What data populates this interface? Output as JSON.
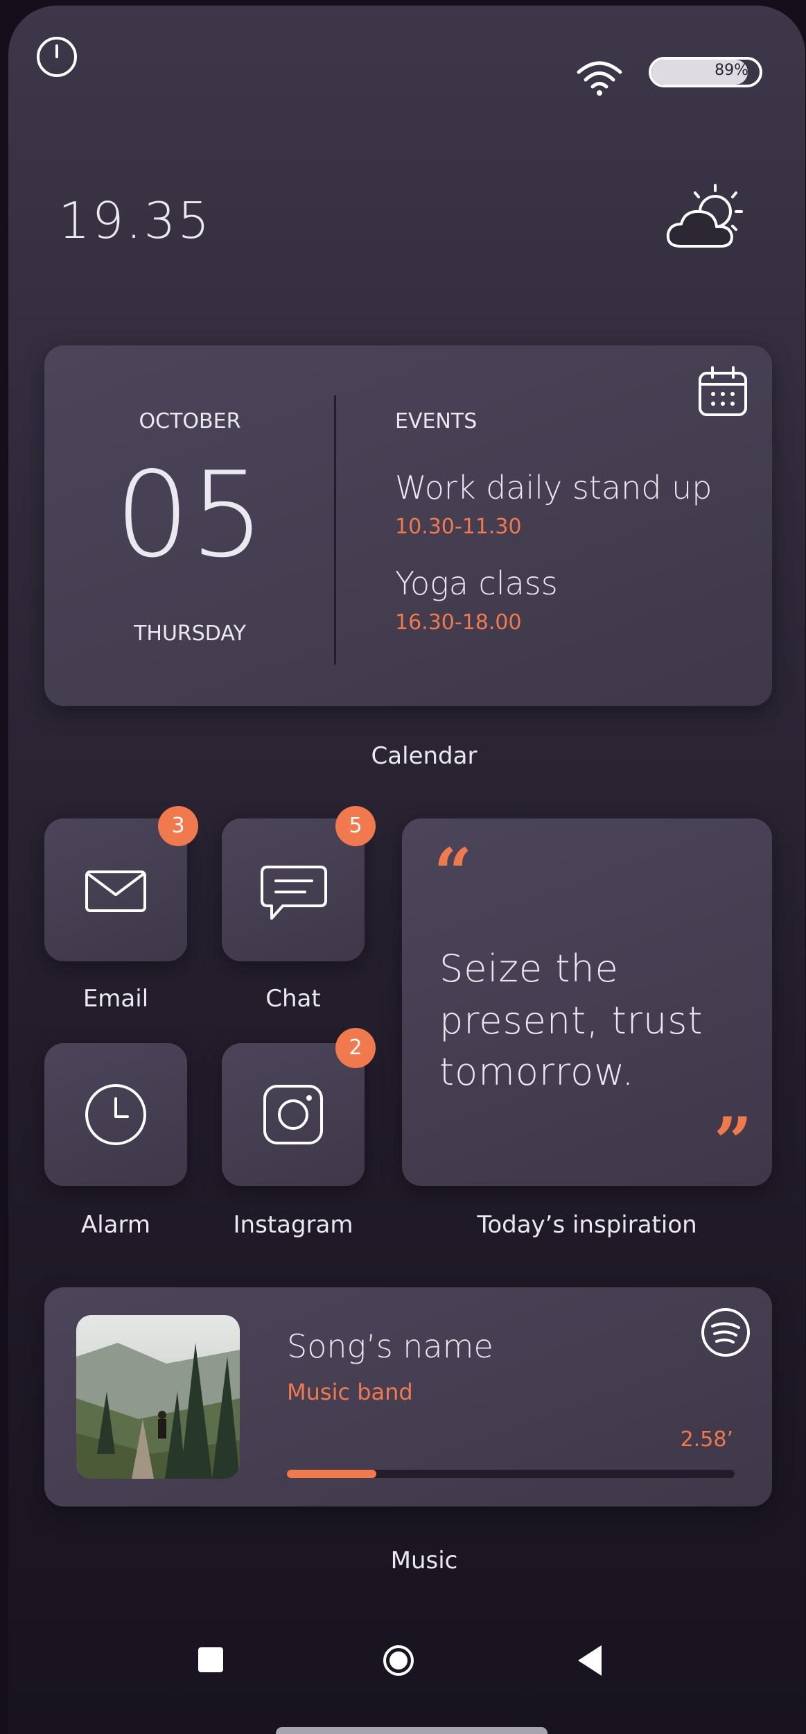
{
  "status_bar": {
    "battery_percent": "89%",
    "battery_level": 0.89
  },
  "clock": {
    "time": "19.35"
  },
  "weather": {
    "icon": "partly-cloudy-sun-icon"
  },
  "calendar": {
    "month": "OCTOBER",
    "day": "05",
    "weekday": "THURSDAY",
    "events_header": "EVENTS",
    "events": [
      {
        "title": "Work daily stand up",
        "time": "10.30-11.30"
      },
      {
        "title": "Yoga class",
        "time": "16.30-18.00"
      }
    ],
    "label": "Calendar"
  },
  "apps": [
    {
      "label": "Email",
      "badge": "3",
      "icon": "mail-icon"
    },
    {
      "label": "Chat",
      "badge": "5",
      "icon": "chat-icon"
    },
    {
      "label": "Alarm",
      "badge": "",
      "icon": "clock-icon"
    },
    {
      "label": "Instagram",
      "badge": "2",
      "icon": "instagram-icon"
    }
  ],
  "quote": {
    "open_mark": "“",
    "text": "Seize the present, trust tomorrow.",
    "close_mark": "”",
    "label": "Today’s inspiration"
  },
  "music": {
    "song": "Song’s name",
    "artist": "Music band",
    "time": "2.58’",
    "progress": 0.2,
    "label": "Music"
  },
  "colors": {
    "accent": "#f07a4e",
    "card": "#463f52",
    "background": "#2a2432"
  }
}
